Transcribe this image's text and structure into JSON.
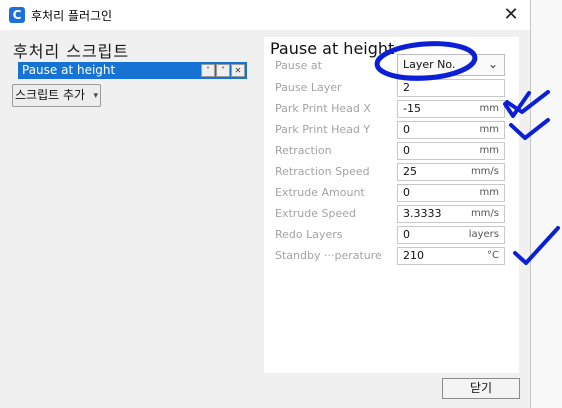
{
  "window": {
    "title": "후처리 플러그인",
    "app_icon_letter": "C",
    "close_glyph": "✕"
  },
  "left_panel": {
    "heading": "후처리 스크립트",
    "scripts": [
      {
        "label": "Pause at height",
        "up": "˄",
        "down": "˅",
        "remove": "✕"
      }
    ],
    "add_script_label": "스크립트 추가",
    "add_script_caret": "▾"
  },
  "right_panel": {
    "title": "Pause at height",
    "pause_at": {
      "label": "Pause at",
      "value": "Layer No.",
      "arrow": "⌄"
    },
    "fields": [
      {
        "label": "Pause Layer",
        "value": "2",
        "unit": ""
      },
      {
        "label": "Park Print Head X",
        "value": "-15",
        "unit": "mm"
      },
      {
        "label": "Park Print Head Y",
        "value": "0",
        "unit": "mm"
      },
      {
        "label": "Retraction",
        "value": "0",
        "unit": "mm"
      },
      {
        "label": "Retraction Speed",
        "value": "25",
        "unit": "mm/s"
      },
      {
        "label": "Extrude Amount",
        "value": "0",
        "unit": "mm"
      },
      {
        "label": "Extrude Speed",
        "value": "3.3333",
        "unit": "mm/s"
      },
      {
        "label": "Redo Layers",
        "value": "0",
        "unit": "layers"
      },
      {
        "label": "Standby ···perature",
        "value": "210",
        "unit": "°C"
      }
    ]
  },
  "footer": {
    "close_label": "닫기"
  },
  "colors": {
    "accent": "#1673d4",
    "annotation_ink": "#0a1fd6"
  }
}
